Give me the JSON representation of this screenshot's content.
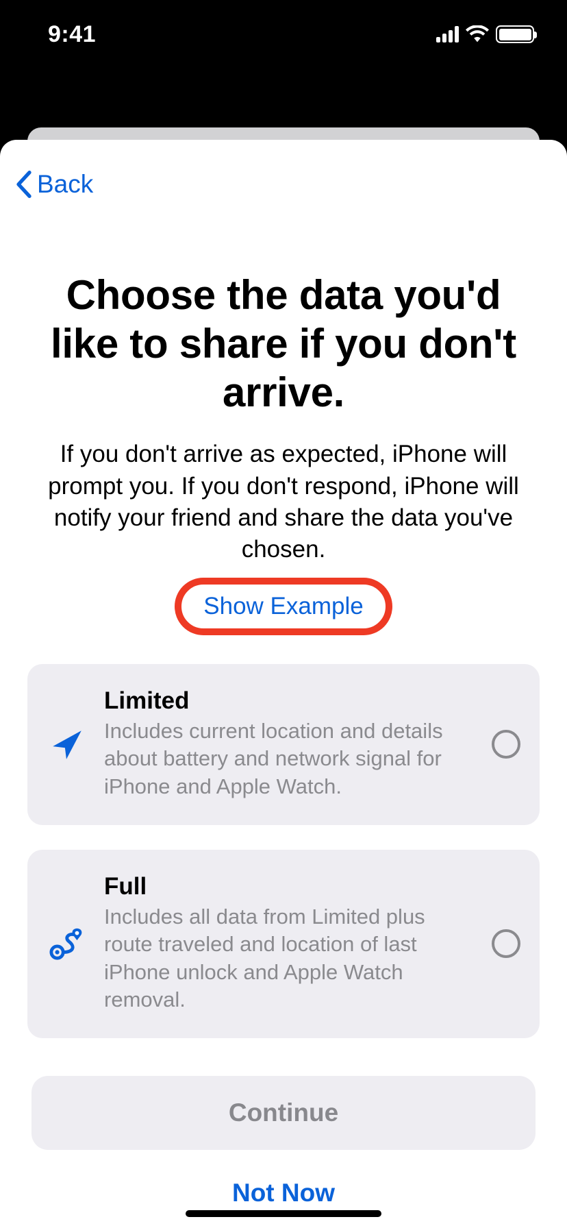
{
  "status": {
    "time": "9:41"
  },
  "nav": {
    "back_label": "Back"
  },
  "hero": {
    "title": "Choose the data you'd like to share if you don't arrive.",
    "description": "If you don't arrive as expected, iPhone will prompt you. If you don't respond, iPhone will notify your friend and share the data you've chosen.",
    "show_example_label": "Show Example"
  },
  "options": [
    {
      "title": "Limited",
      "description": "Includes current location and details about battery and network signal for iPhone and Apple Watch."
    },
    {
      "title": "Full",
      "description": "Includes all data from Limited plus route traveled and location of last iPhone unlock and Apple Watch removal."
    }
  ],
  "footer": {
    "continue_label": "Continue",
    "not_now_label": "Not Now"
  },
  "colors": {
    "accent": "#0a62d9",
    "highlight_ring": "#ee3a24",
    "card_bg": "#eeedf2",
    "secondary_text": "#8a8a8e"
  }
}
